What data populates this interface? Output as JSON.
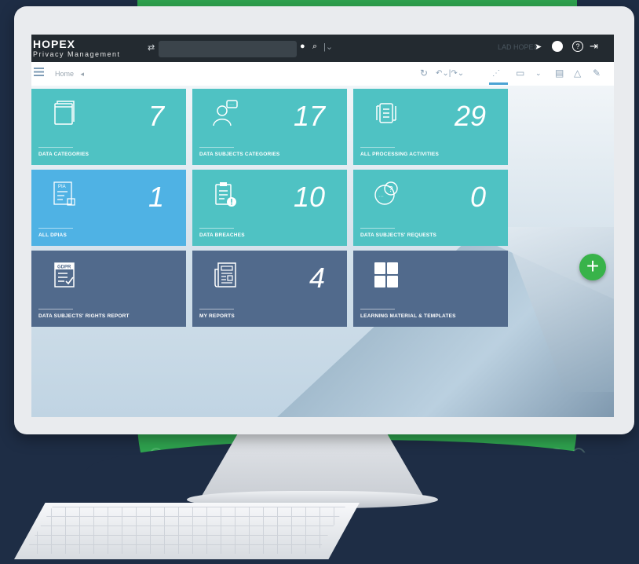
{
  "app": {
    "brand_name": "HOPEX",
    "brand_sub": "Privacy Management",
    "user_label": "LAD HOPEX"
  },
  "toolbar": {
    "home_label": "Home",
    "back_icon": "◂"
  },
  "tiles": [
    {
      "label": "DATA CATEGORIES",
      "count": "7",
      "icon": "book-icon",
      "color": "#4fc2c3"
    },
    {
      "label": "DATA SUBJECTS CATEGORIES",
      "count": "17",
      "icon": "person-chat-icon",
      "color": "#4fc2c3"
    },
    {
      "label": "ALL PROCESSING ACTIVITIES",
      "count": "29",
      "icon": "process-flow-icon",
      "color": "#4fc2c3"
    },
    {
      "label": "ALL DPIAS",
      "count": "1",
      "icon": "pia-document-icon",
      "color": "#4fb2e4",
      "icon_text": "PIA"
    },
    {
      "label": "DATA BREACHES",
      "count": "10",
      "icon": "clipboard-alert-icon",
      "color": "#4fc2c3"
    },
    {
      "label": "DATA SUBJECTS' REQUESTS",
      "count": "0",
      "icon": "question-bubble-icon",
      "color": "#4fc2c3"
    },
    {
      "label": "DATA SUBJECTS' RIGHTS REPORT",
      "count": "",
      "icon": "gdpr-document-icon",
      "color": "#516a8c",
      "icon_text": "GDPR"
    },
    {
      "label": "MY REPORTS",
      "count": "4",
      "icon": "newspaper-icon",
      "color": "#516a8c"
    },
    {
      "label": "LEARNING MATERIAL & TEMPLATES",
      "count": "",
      "icon": "grid-tiles-icon",
      "color": "#516a8c"
    }
  ],
  "fab": {
    "label": "+"
  }
}
